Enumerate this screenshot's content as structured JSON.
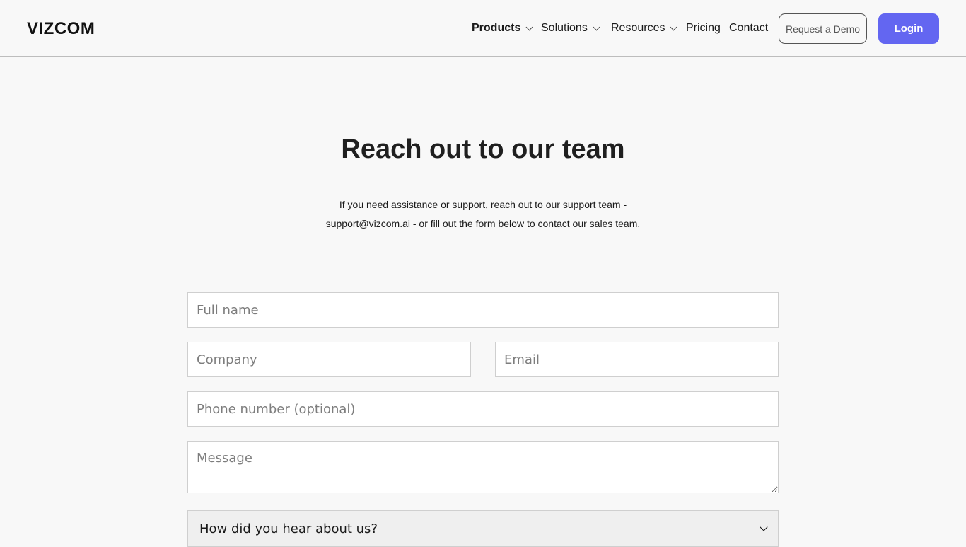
{
  "header": {
    "logo": "VIZCOM",
    "nav": [
      {
        "label": "Products",
        "icon": "chevron-down-icon"
      },
      {
        "label": "Solutions",
        "icon": "chevron-down-icon"
      },
      {
        "label": "Resources",
        "icon": "chevron-down-icon"
      },
      {
        "label": "Pricing"
      },
      {
        "label": "Contact"
      }
    ],
    "demo_button": "Request a Demo",
    "login_button": "Login"
  },
  "hero": {
    "title": "Reach out to our team",
    "subtitle_line1": "If you need assistance or support, reach out to  our support team -",
    "subtitle_line2": "support@vizcom.ai - or fill out the form below to contact our sales team."
  },
  "form": {
    "full_name_placeholder": "Full name",
    "company_placeholder": "Company",
    "email_placeholder": "Email",
    "phone_placeholder": "Phone number (optional)",
    "message_placeholder": "Message",
    "source_select_value": "How did you hear about us?"
  },
  "colors": {
    "accent": "#6366f1",
    "background": "#f8f8f8"
  }
}
